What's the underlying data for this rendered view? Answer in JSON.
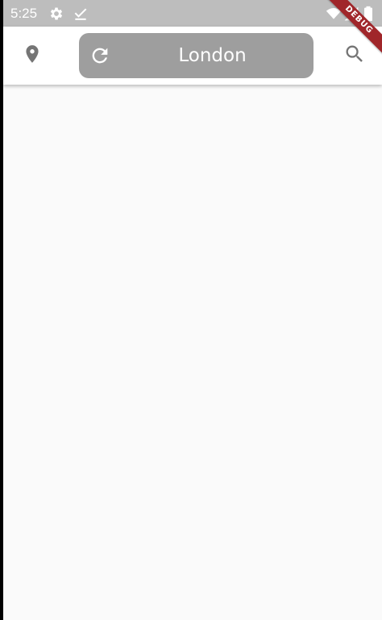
{
  "status_bar": {
    "time": "5:25",
    "icons": [
      "gear-icon",
      "download-done-icon",
      "wifi-icon",
      "signal-icon",
      "battery-icon"
    ]
  },
  "app_bar": {
    "location_icon": "location-pin-icon",
    "refresh_icon": "refresh-icon",
    "city": "London",
    "search_icon": "search-icon"
  },
  "debug_banner": {
    "label": "DEBUG"
  },
  "colors": {
    "status_bar_bg": "#bdbdbd",
    "app_bar_bg": "#ffffff",
    "pill_bg": "#9e9e9e",
    "icon_grey": "#757575",
    "content_bg": "#fafafa",
    "banner_red": "#a0262a"
  }
}
